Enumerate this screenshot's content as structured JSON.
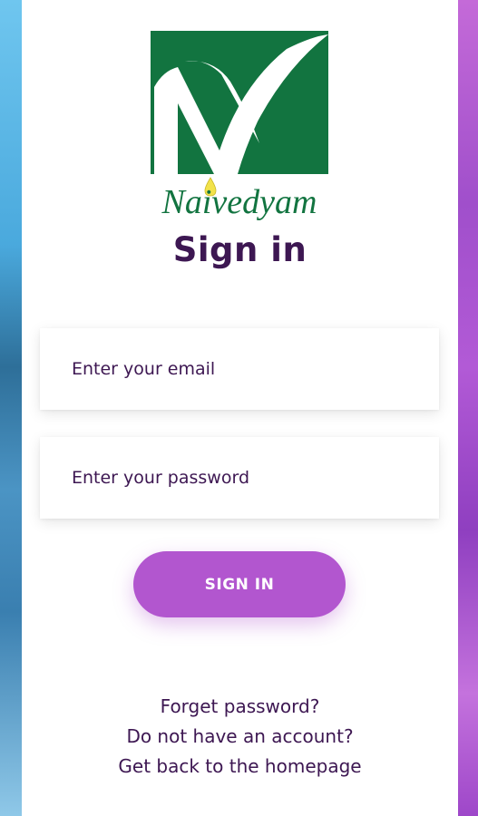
{
  "brand": {
    "name": "Naivedyam",
    "logo_green": "#127440",
    "accent_yellow": "#f2e24a"
  },
  "title": "Sign in",
  "form": {
    "email_placeholder": "Enter your email",
    "password_placeholder": "Enter your password",
    "submit_label": "SIGN IN"
  },
  "links": {
    "forgot_password": "Forget password?",
    "no_account": "Do not have an account?",
    "homepage": "Get back to the homepage"
  },
  "colors": {
    "text": "#3d1752",
    "button": "#b256cf"
  }
}
